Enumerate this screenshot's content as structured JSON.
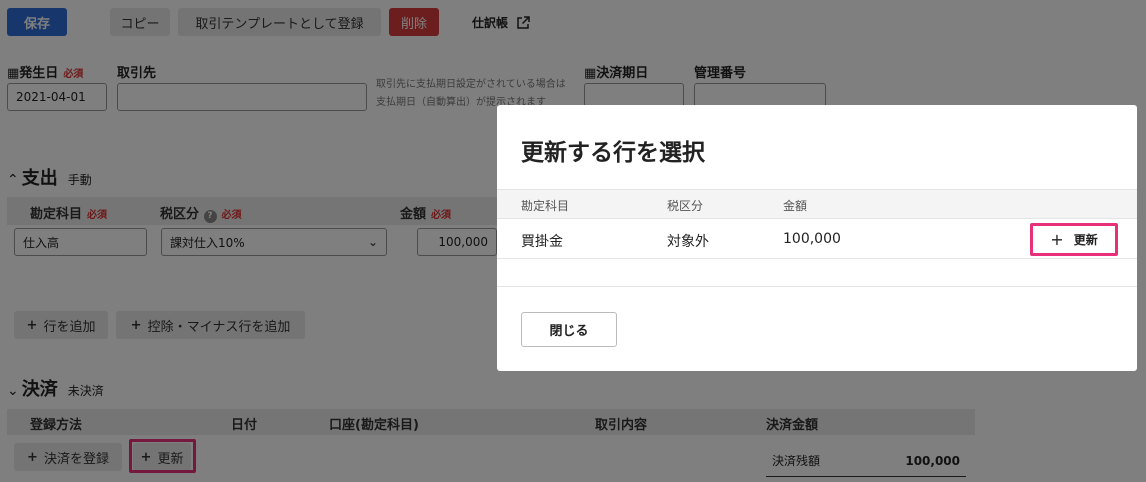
{
  "toolbar": {
    "save_label": "保存",
    "copy_label": "コピー",
    "template_label": "取引テンプレートとして登録",
    "delete_label": "削除",
    "journal_label": "仕訳帳"
  },
  "header_fields": {
    "date_label": "発生日",
    "required": "必須",
    "date_value": "2021-04-01",
    "partner_label": "取引先",
    "partner_value": "",
    "partner_hint_1": "取引先に支払期日設定がされている場合は",
    "partner_hint_2": "支払期日（自動算出）が提示されます",
    "due_label": "決済期日",
    "manage_label": "管理番号"
  },
  "expense": {
    "section_title": "支出",
    "mode": "手動",
    "col_account": "勘定科目",
    "col_tax": "税区分",
    "col_amount": "金額",
    "account_value": "仕入高",
    "tax_value": "課対仕入10%",
    "amount_value": "100,000",
    "add_row_label": "行を追加",
    "add_deduct_label": "控除・マイナス行を追加"
  },
  "settlement": {
    "section_title": "決済",
    "status": "未決済",
    "col_method": "登録方法",
    "col_date": "日付",
    "col_account": "口座(勘定科目)",
    "col_content": "取引内容",
    "col_amount": "決済金額",
    "register_label": "決済を登録",
    "update_label": "更新",
    "balance_label": "決済残額",
    "balance_value": "100,000"
  },
  "modal": {
    "title": "更新する行を選択",
    "col_account": "勘定科目",
    "col_tax": "税区分",
    "col_amount": "金額",
    "row_account": "買掛金",
    "row_tax": "対象外",
    "row_amount": "100,000",
    "update_label": "更新",
    "close_label": "閉じる"
  },
  "colors": {
    "save": "#2f6fd8",
    "delete": "#d93a3a",
    "highlight": "#e8307a",
    "required": "#d33333"
  }
}
